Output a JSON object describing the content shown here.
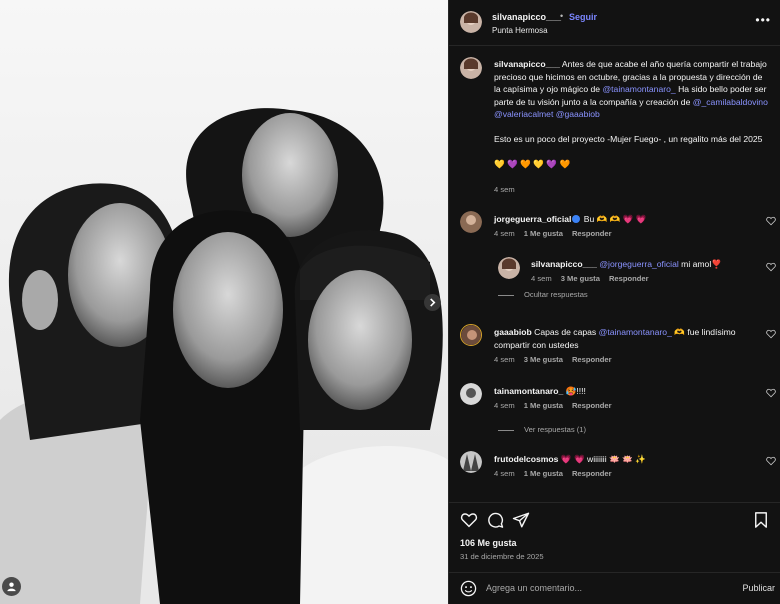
{
  "post": {
    "author": "silvanapicco___",
    "dot": "•",
    "follow_label": "Seguir",
    "location": "Punta Hermosa",
    "more_icon": "more-icon"
  },
  "caption": {
    "user": "silvanapicco___",
    "text1": "Antes de que acabe el año quería compartir el trabajo precioso que hicimos en octubre, gracias a la propuesta y dirección de la capísima y ojo mágico de",
    "mention1": "@tainamontanaro_",
    "text2": "Ha sido bello poder ser parte de tu visión junto a la compañía y creación de",
    "mention2": "@_camilabaldovino",
    "mention3": "@valeriacalmet",
    "mention4": "@gaaabiob",
    "text3": "Esto es un poco del proyecto -Mujer Fuego- , un regalito más del 2025",
    "emojis": "💛 💜 🧡 💛 💜 🧡",
    "time": "4 sem"
  },
  "comments": [
    {
      "user": "jorgeguerra_oficial",
      "text": "Bu 🫶 🫶 💗 💗",
      "time": "4 sem",
      "likes": "1 Me gusta",
      "reply": "Responder"
    },
    {
      "user": "silvanapicco___",
      "mention": "@jorgeguerra_oficial",
      "text": "mi amol❣️",
      "time": "4 sem",
      "likes": "3 Me gusta",
      "reply": "Responder"
    },
    {
      "user": "gaaabiob",
      "text1": "Capas de capas",
      "mention": "@tainamontanaro_",
      "text2": "🫶 fue lindísimo compartir con ustedes",
      "time": "4 sem",
      "likes": "3 Me gusta",
      "reply": "Responder"
    },
    {
      "user": "tainamontanaro_",
      "text": "🥵!!!!",
      "time": "4 sem",
      "likes": "1 Me gusta",
      "reply": "Responder"
    },
    {
      "user": "frutodelcosmos",
      "text": "💗 💗 wiiiiiii 🪷 🪷 ✨",
      "time": "4 sem",
      "likes": "1 Me gusta",
      "reply": "Responder"
    }
  ],
  "links": {
    "hide_replies": "Ocultar respuestas",
    "view_replies": "Ver respuestas (1)"
  },
  "actions": {
    "likes": "106 Me gusta",
    "date": "31 de diciembre de 2025"
  },
  "comment_box": {
    "placeholder": "Agrega un comentario...",
    "submit": "Publicar"
  },
  "colors": {
    "background": "#121212",
    "link": "#8a93ff",
    "follow": "#7b86ff"
  }
}
